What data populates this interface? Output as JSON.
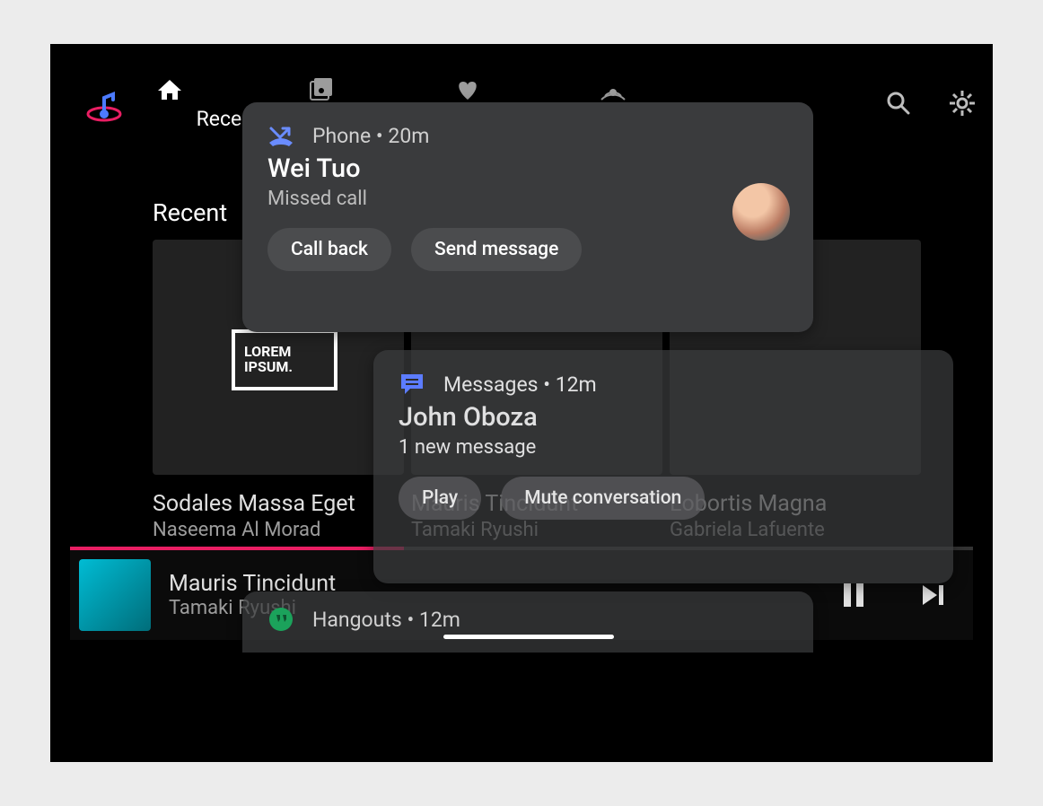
{
  "nav": {
    "tabs": [
      "Recent",
      "Library",
      "Favorites",
      "Radio"
    ],
    "section_title": "Recent"
  },
  "albums": [
    {
      "title": "Sodales Massa Eget",
      "artist": "Naseema Al Morad",
      "label_top": "LOREM",
      "label_bot": "IPSUM."
    },
    {
      "title": "Mauris Tincidunt",
      "artist": "Tamaki Ryushi"
    },
    {
      "title": "Lobortis Magna",
      "artist": "Gabriela Lafuente"
    }
  ],
  "now_playing": {
    "title": "Mauris Tincidunt",
    "artist": "Tamaki Ryushi"
  },
  "notifications": [
    {
      "app": "Phone",
      "time": "20m",
      "title": "Wei Tuo",
      "sub": "Missed call",
      "actions": [
        "Call back",
        "Send message"
      ],
      "icon": "missed-call",
      "icon_color": "#6A8CFF"
    },
    {
      "app": "Messages",
      "time": "12m",
      "title": "John Oboza",
      "sub": "1 new message",
      "actions": [
        "Play",
        "Mute conversation"
      ],
      "icon": "messages",
      "icon_color": "#5C7CFF"
    },
    {
      "app": "Hangouts",
      "time": "12m",
      "icon": "hangouts",
      "icon_color": "#1BA25B"
    }
  ]
}
